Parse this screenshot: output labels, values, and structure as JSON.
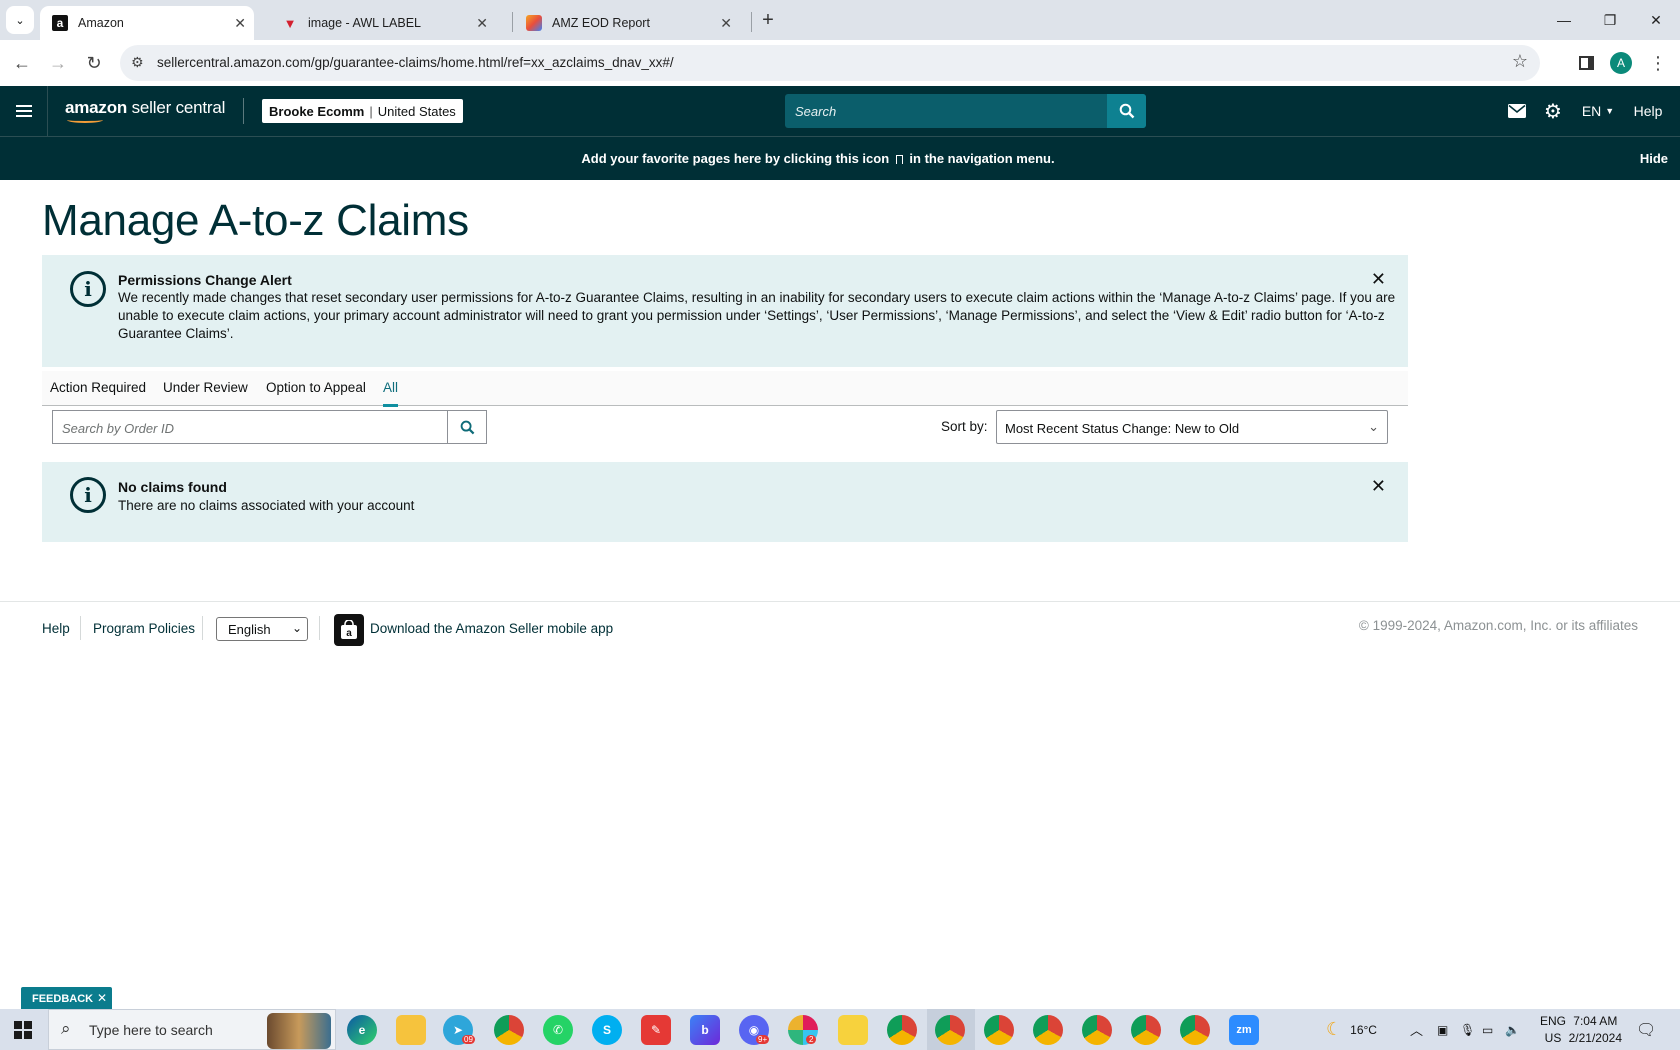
{
  "browser": {
    "tabs": [
      {
        "title": "Amazon",
        "active": true
      },
      {
        "title": "image - AWL LABEL",
        "active": false
      },
      {
        "title": "AMZ EOD Report",
        "active": false
      }
    ],
    "url": "sellercentral.amazon.com/gp/guarantee-claims/home.html/ref=xx_azclaims_dnav_xx#/",
    "profile_initial": "A"
  },
  "header": {
    "logo_brand": "amazon",
    "logo_product": "seller central",
    "account_name": "Brooke Ecomm",
    "account_marketplace": "United States",
    "search_placeholder": "Search",
    "language": "EN",
    "help_label": "Help"
  },
  "favorites_bar": {
    "message_before": "Add your favorite pages here by clicking this icon",
    "message_after": "in the navigation menu.",
    "hide_label": "Hide"
  },
  "page": {
    "title": "Manage A-to-z Claims",
    "permissions_alert": {
      "title": "Permissions Change Alert",
      "body": "We recently made changes that reset secondary user permissions for A-to-z Guarantee Claims, resulting in an inability for secondary users to execute claim actions within the ‘Manage A-to-z Claims’ page. If you are unable to execute claim actions, your primary account administrator will need to grant you permission under ‘Settings’, ‘User Permissions’, ‘Manage Permissions’, and select the ‘View & Edit’ radio button for ‘A-to-z Guarantee Claims’."
    },
    "tabs": [
      {
        "label": "Action Required",
        "selected": false
      },
      {
        "label": "Under Review",
        "selected": false
      },
      {
        "label": "Option to Appeal",
        "selected": false
      },
      {
        "label": "All",
        "selected": true
      }
    ],
    "order_search_placeholder": "Search by Order ID",
    "sort_label": "Sort by:",
    "sort_value": "Most Recent Status Change: New to Old",
    "no_claims_alert": {
      "title": "No claims found",
      "body": "There are no claims associated with your account"
    }
  },
  "footer": {
    "help": "Help",
    "program_policies": "Program Policies",
    "language": "English",
    "app_link": "Download the Amazon Seller mobile app",
    "copyright": "© 1999-2024, Amazon.com, Inc. or its affiliates"
  },
  "feedback_label": "FEEDBACK",
  "taskbar": {
    "search_placeholder": "Type here to search",
    "weather": "16°C",
    "lang_line1": "ENG",
    "lang_line2": "US",
    "time": "7:04 AM",
    "date": "2/21/2024",
    "telegram_badge": "09",
    "discord_badge": "9+",
    "slack_badge": "2"
  },
  "colors": {
    "header_bg": "#002f36",
    "accent": "#0e8191",
    "alert_bg": "#e3f1f2"
  }
}
